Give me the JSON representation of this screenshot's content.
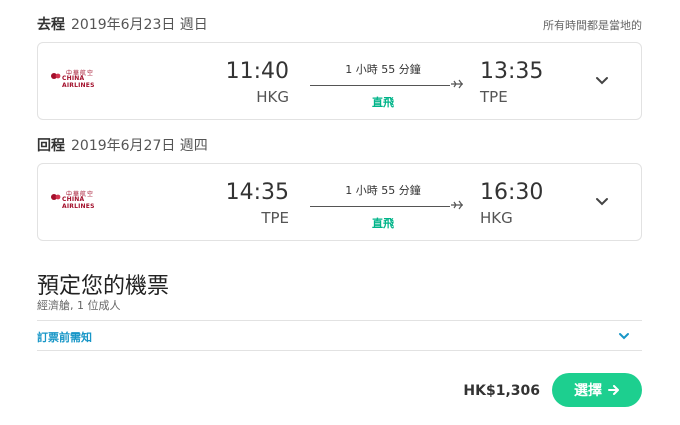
{
  "outbound": {
    "direction": "去程",
    "date": "2019年6月23日 週日",
    "dep_time": "11:40",
    "dep_code": "HKG",
    "arr_time": "13:35",
    "arr_code": "TPE",
    "duration": "1 小時 55 分鐘",
    "stops": "直飛",
    "airline_zh": "中華航空",
    "airline_en": "CHINA AIRLINES"
  },
  "return": {
    "direction": "回程",
    "date": "2019年6月27日 週四",
    "dep_time": "14:35",
    "dep_code": "TPE",
    "arr_time": "16:30",
    "arr_code": "HKG",
    "duration": "1 小時 55 分鐘",
    "stops": "直飛",
    "airline_zh": "中華航空",
    "airline_en": "CHINA AIRLINES"
  },
  "local_time_note": "所有時間都是當地的",
  "booking": {
    "title": "預定您的機票",
    "subtitle": "經濟艙, 1 位成人",
    "notice_label": "訂票前需知"
  },
  "price": "HK$1,306",
  "select_label": "選擇",
  "colors": {
    "brand_green": "#1dcf8f",
    "direct_green": "#00b489",
    "link_blue": "#1796c7",
    "airline_red": "#a3102c"
  }
}
